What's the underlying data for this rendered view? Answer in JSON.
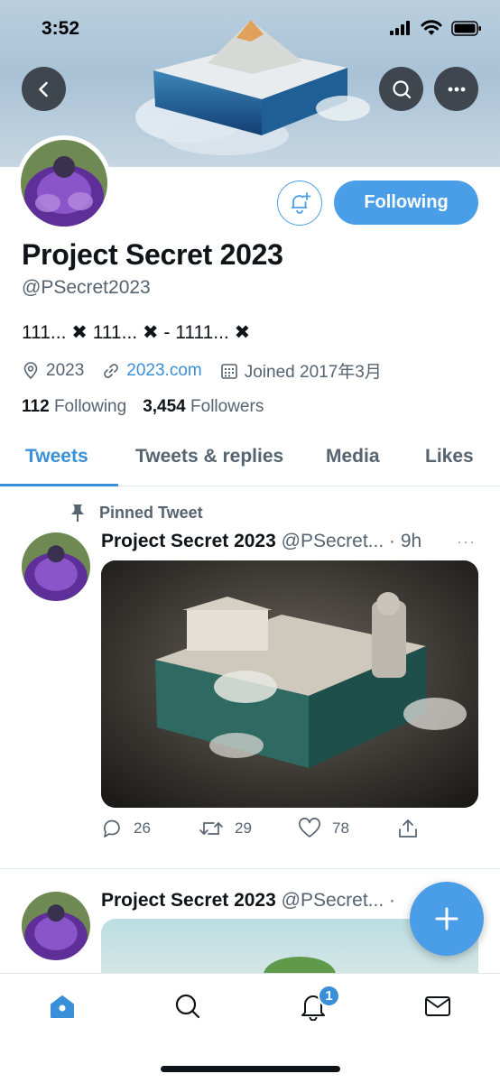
{
  "status_bar": {
    "time": "3:52"
  },
  "header": {
    "back_icon": "chevron-left-icon",
    "search_icon": "search-icon",
    "more_icon": "more-horizontal-icon"
  },
  "profile": {
    "name": "Project Secret 2023",
    "handle": "@PSecret2023",
    "bio": "111... ✖ 111... ✖ - 1111... ✖",
    "location": "2023",
    "website": "2023.com",
    "joined": "Joined 2017年3月",
    "following_count": "112",
    "following_label": "Following",
    "followers_count": "3,454",
    "followers_label": "Followers",
    "follow_button": "Following"
  },
  "tabs": [
    {
      "label": "Tweets",
      "active": true
    },
    {
      "label": "Tweets & replies",
      "active": false
    },
    {
      "label": "Media",
      "active": false
    },
    {
      "label": "Likes",
      "active": false
    }
  ],
  "tweets": [
    {
      "pinned_label": "Pinned Tweet",
      "name": "Project Secret 2023",
      "handle_time": "@PSecret... · 9h",
      "more": "···",
      "replies": "26",
      "retweets": "29",
      "likes": "78"
    },
    {
      "name": "Project Secret 2023",
      "handle_time": "@PSecret... ·"
    }
  ],
  "bottom_nav": {
    "notification_badge": "1"
  },
  "colors": {
    "accent": "#4a9ee8",
    "link": "#3a8fd9",
    "text": "#0f1419",
    "secondary": "#566370"
  }
}
